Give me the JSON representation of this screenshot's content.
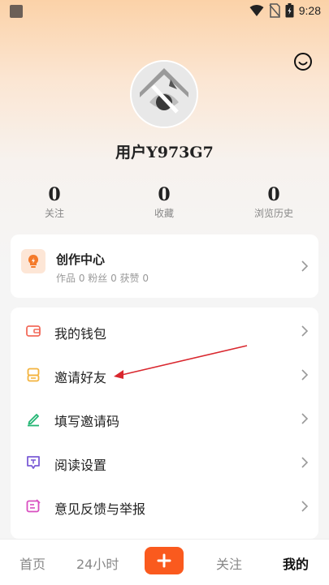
{
  "status_bar": {
    "time": "9:28"
  },
  "profile": {
    "username": "用户Y973G7"
  },
  "stats": [
    {
      "value": "0",
      "label": "关注"
    },
    {
      "value": "0",
      "label": "收藏"
    },
    {
      "value": "0",
      "label": "浏览历史"
    }
  ],
  "creator_center": {
    "title": "创作中心",
    "subtitle": "作品 0 粉丝 0 获赞 0",
    "icon": "lightbulb-icon"
  },
  "menu": [
    {
      "label": "我的钱包",
      "icon": "wallet-icon",
      "color": "#f26b5b"
    },
    {
      "label": "邀请好友",
      "icon": "invite-icon",
      "color": "#f3b33d"
    },
    {
      "label": "填写邀请码",
      "icon": "pen-icon",
      "color": "#22b573"
    },
    {
      "label": "阅读设置",
      "icon": "reading-settings-icon",
      "color": "#7b5cd6"
    },
    {
      "label": "意见反馈与举报",
      "icon": "feedback-icon",
      "color": "#d94fc0"
    }
  ],
  "tabbar": {
    "tabs": [
      "首页",
      "24小时",
      "关注",
      "我的"
    ],
    "active": "我的",
    "plus_color": "#fa5a1e"
  },
  "colors": {
    "accent": "#fa5a1e",
    "annotation_arrow": "#d9272e"
  }
}
